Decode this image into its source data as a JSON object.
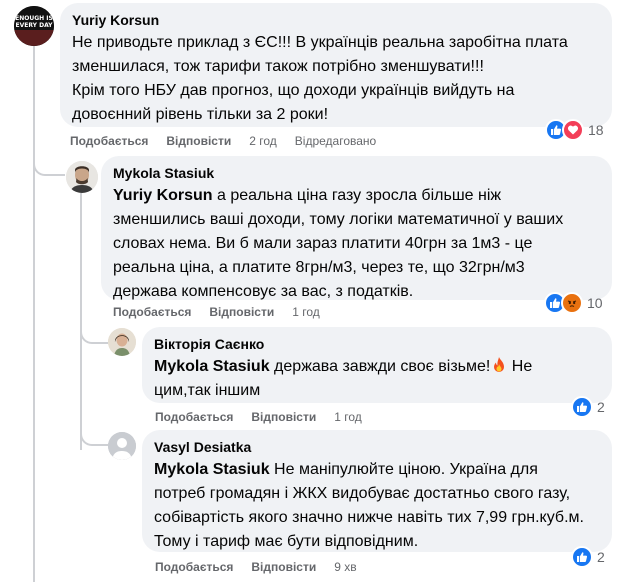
{
  "comments": [
    {
      "author": "Yuriy Korsun",
      "lines": [
        "Не приводьте приклад з ЄС!!! В українців реальна заробітна плата",
        "зменшилася, тож тарифи також потрібно зменшувати!!!",
        "Крім того НБУ дав прогноз, що доходи українців вийдуть на",
        "довоєнний рівень тільки за 2 роки!"
      ],
      "like": "Подобається",
      "reply": "Відповісти",
      "time": "2 год",
      "edited": "Відредаговано",
      "reaction_count": "18"
    },
    {
      "author": "Mykola Stasiuk",
      "mention": "Yuriy Korsun",
      "line1_rest": " а реальна ціна газу зросла більше ніж",
      "lines": [
        "зменшились ваші доходи, тому логіки математичної у ваших",
        "словах нема. Ви б мали зараз платити 40грн за 1м3 - це",
        "реальна ціна, а платите 8грн/м3, через те, що 32грн/м3",
        "держава компенсовує за вас, з податків."
      ],
      "like": "Подобається",
      "reply": "Відповісти",
      "time": "1 год",
      "reaction_count": "10"
    },
    {
      "author": "Вікторія Саєнко",
      "mention": "Mykola Stasiuk",
      "line1_rest": " держава завжди своє візьме!",
      "line1_tail": " Не",
      "lines": [
        "цим,так іншим"
      ],
      "like": "Подобається",
      "reply": "Відповісти",
      "time": "1 год",
      "reaction_count": "2"
    },
    {
      "author": "Vasyl Desiatka",
      "mention": "Mykola Stasiuk",
      "line1_rest": " Не маніпулюйте ціною. Україна для",
      "lines": [
        "потреб громадян і ЖКХ видобуває достатньо свого газу,",
        "собівартість якого значно нижче навіть тих 7,99 грн.куб.м.",
        "Тому і тариф має бути відповідним."
      ],
      "like": "Подобається",
      "reply": "Відповісти",
      "time": "9 хв",
      "reaction_count": "2"
    }
  ],
  "avatar1_text": [
    "ENOUGH IS",
    "EVERY DAY"
  ],
  "colors": {
    "like": "#1877f2",
    "love": "#f33e58",
    "angry": "#e9710f",
    "text": "#050505",
    "meta": "#65676b",
    "bubble": "#f0f2f5"
  },
  "icons": [
    "like-reaction-icon",
    "love-reaction-icon",
    "angry-reaction-icon",
    "fire-emoji-icon",
    "default-avatar-icon"
  ]
}
